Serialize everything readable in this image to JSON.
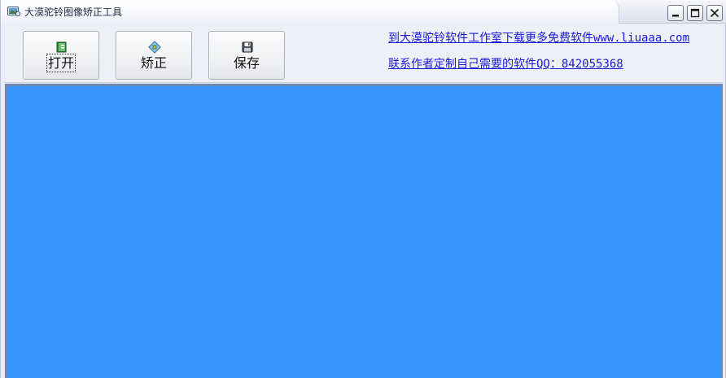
{
  "window": {
    "title": "大漠驼铃图像矫正工具",
    "app_icon": "image-app-icon",
    "controls": [
      "minimize",
      "maximize",
      "close"
    ]
  },
  "toolbar": {
    "open_label": "打开",
    "open_icon": "open-book-icon",
    "correct_label": "矫正",
    "correct_icon": "image-correct-icon",
    "save_label": "保存",
    "save_icon": "floppy-disk-icon"
  },
  "links": {
    "download": "到大漠驼铃软件工作室下载更多免费软件www.liuaaa.com",
    "contact": "联系作者定制自己需要的软件QQ：842055368"
  },
  "colors": {
    "canvas_background": "#3895fe",
    "link": "#1a1ad6"
  }
}
